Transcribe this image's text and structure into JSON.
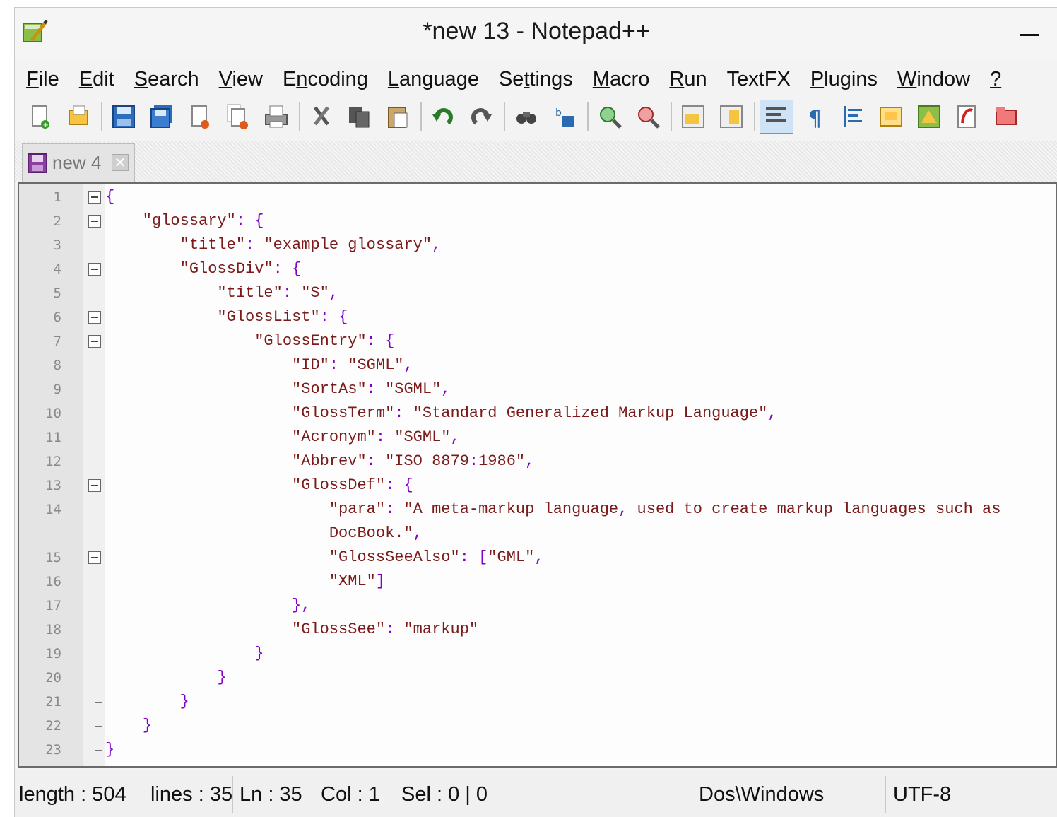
{
  "window": {
    "title": "*new 13 - Notepad++"
  },
  "menu": [
    "File",
    "Edit",
    "Search",
    "View",
    "Encoding",
    "Language",
    "Settings",
    "Macro",
    "Run",
    "TextFX",
    "Plugins",
    "Window",
    "?"
  ],
  "menu_underline_index": [
    0,
    0,
    0,
    0,
    1,
    0,
    2,
    0,
    0,
    -1,
    0,
    0,
    0
  ],
  "toolbar": [
    "new-file-icon",
    "open-file-icon",
    "save-icon",
    "save-all-icon",
    "close-icon",
    "close-all-icon",
    "print-icon",
    "cut-icon",
    "copy-icon",
    "paste-icon",
    "undo-icon",
    "redo-icon",
    "find-icon",
    "replace-icon",
    "zoom-in-icon",
    "zoom-out-icon",
    "sync-vertical-icon",
    "sync-horizontal-icon",
    "word-wrap-icon",
    "show-all-chars-icon",
    "indent-guide-icon",
    "user-lang-icon",
    "doc-map-icon",
    "function-list-icon",
    "folder-icon"
  ],
  "tab": {
    "label": "new 4",
    "close": "✕"
  },
  "editor": {
    "lines": [
      {
        "n": "1",
        "text": "{",
        "fold": "box"
      },
      {
        "n": "2",
        "text": "    \"glossary\": {",
        "fold": "box"
      },
      {
        "n": "3",
        "text": "        \"title\": \"example glossary\",",
        "fold": "line"
      },
      {
        "n": "4",
        "text": "        \"GlossDiv\": {",
        "fold": "box"
      },
      {
        "n": "5",
        "text": "            \"title\": \"S\",",
        "fold": "line"
      },
      {
        "n": "6",
        "text": "            \"GlossList\": {",
        "fold": "box"
      },
      {
        "n": "7",
        "text": "                \"GlossEntry\": {",
        "fold": "box"
      },
      {
        "n": "8",
        "text": "                    \"ID\": \"SGML\",",
        "fold": "line"
      },
      {
        "n": "9",
        "text": "                    \"SortAs\": \"SGML\",",
        "fold": "line"
      },
      {
        "n": "10",
        "text": "                    \"GlossTerm\": \"Standard Generalized Markup Language\",",
        "fold": "line"
      },
      {
        "n": "11",
        "text": "                    \"Acronym\": \"SGML\",",
        "fold": "line"
      },
      {
        "n": "12",
        "text": "                    \"Abbrev\": \"ISO 8879:1986\",",
        "fold": "line"
      },
      {
        "n": "13",
        "text": "                    \"GlossDef\": {",
        "fold": "box"
      },
      {
        "n": "14",
        "text": "                        \"para\": \"A meta-markup language, used to create markup languages such as",
        "fold": "line"
      },
      {
        "n": "",
        "text": "                        DocBook.\",",
        "fold": "line"
      },
      {
        "n": "15",
        "text": "                        \"GlossSeeAlso\": [\"GML\",",
        "fold": "box"
      },
      {
        "n": "16",
        "text": "                        \"XML\"]",
        "fold": "tick"
      },
      {
        "n": "17",
        "text": "                    },",
        "fold": "tick"
      },
      {
        "n": "18",
        "text": "                    \"GlossSee\": \"markup\"",
        "fold": "line"
      },
      {
        "n": "19",
        "text": "                }",
        "fold": "tick"
      },
      {
        "n": "20",
        "text": "            }",
        "fold": "tick"
      },
      {
        "n": "21",
        "text": "        }",
        "fold": "tick"
      },
      {
        "n": "22",
        "text": "    }",
        "fold": "tick"
      },
      {
        "n": "23",
        "text": "}",
        "fold": "end"
      }
    ]
  },
  "status": {
    "length": "length : 504",
    "lines": "lines : 35",
    "ln": "Ln : 35",
    "col": "Col : 1",
    "sel": "Sel : 0 | 0",
    "eol": "Dos\\Windows",
    "encoding": "UTF-8"
  },
  "colors": {
    "keyword": "#7a1a1a",
    "operator": "#8000c8",
    "gutter": "#e4e4e4",
    "selection": "#cfe3f7"
  }
}
